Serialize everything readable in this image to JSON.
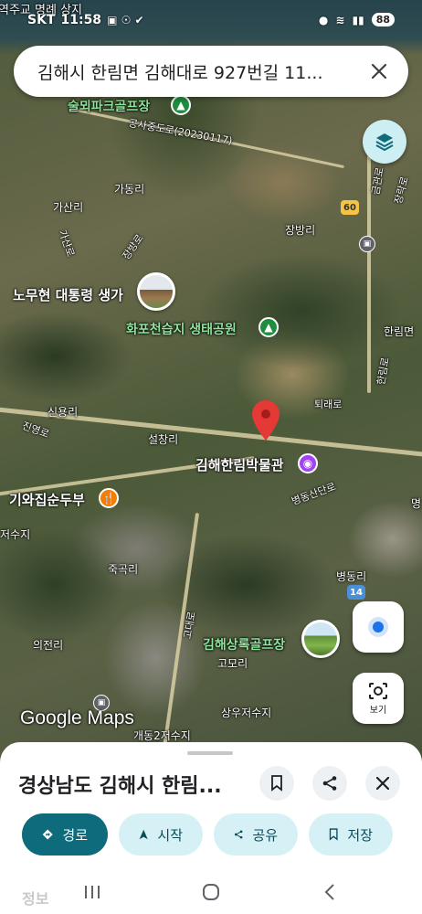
{
  "status_bar": {
    "carrier": "SKT",
    "time": "11:58",
    "battery": "88"
  },
  "search": {
    "query": "김해시 한림면 김해대로 927번길 11..."
  },
  "map": {
    "labels": {
      "top_left": "역주교 명례 상지",
      "golf1": "술뫼파크골프장",
      "road1": "공사중도로(20230117)",
      "gasanri": "가산리",
      "gadongri": "가동리",
      "gasanro": "가산로",
      "jangbangro": "장방로",
      "jangbangri": "장방리",
      "roh_house": "노무현 대통령 생가",
      "hwapo": "화포천습지 생태공원",
      "hanrimmyeon": "한림면",
      "hanrimro": "한림로",
      "geumgwanro": "금관로",
      "jangrakro": "장락로",
      "sinyongri": "신용리",
      "jinyeongro": "진영로",
      "seolchangri": "설창리",
      "toeraero": "퇴래로",
      "museum": "김해한림박물관",
      "byeongdong_sandan": "병동산단로",
      "restaurant": "기와집순두부",
      "reservoir1": "저수지",
      "jukgokri": "죽곡리",
      "byeongdongri": "병동리",
      "uijeonri": "의전리",
      "gomori": "고모리",
      "godaero": "고대로",
      "golf2": "김해상록골프장",
      "reservoir2": "상우저수지",
      "reservoir3": "개동2저수지",
      "shield60": "60",
      "shield14": "14",
      "ming": "명"
    },
    "logo": "Google Maps"
  },
  "lens_button": {
    "label": "보기"
  },
  "sheet": {
    "title": "경상남도 김해시 한림...",
    "chips": [
      {
        "label": "경로",
        "icon": "directions-icon"
      },
      {
        "label": "시작",
        "icon": "navigation-icon"
      },
      {
        "label": "공유",
        "icon": "share-icon"
      },
      {
        "label": "저장",
        "icon": "bookmark-icon"
      }
    ],
    "info_tab": "정보"
  },
  "colors": {
    "primary_chip": "#0d6b7c",
    "chip": "#d6f1f6",
    "pin": "#e53935",
    "location": "#1a73e8"
  }
}
